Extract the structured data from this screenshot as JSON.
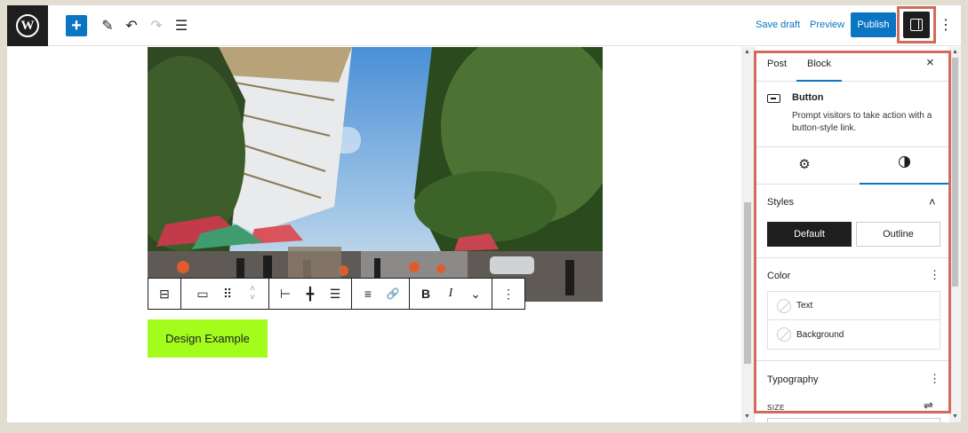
{
  "topbar": {
    "logo": "W",
    "add_icon": "+",
    "pen_icon": "✎",
    "undo_icon": "↶",
    "redo_icon": "↷",
    "outline_icon": "☰",
    "save_draft": "Save draft",
    "preview": "Preview",
    "publish": "Publish",
    "kebab_icon": "⋮"
  },
  "canvas": {
    "button_text": "Design Example"
  },
  "toolbar": {
    "transform_icon": "⊟",
    "button_icon": "▭",
    "drag_icon": "⠿",
    "up_icon": "˄",
    "down_icon": "˅",
    "justify_left_icon": "⊢",
    "justify_center_icon": "╋",
    "justify_space_icon": "☰",
    "align_icon": "≡",
    "link_icon": "🔗",
    "bold": "B",
    "italic": "I",
    "more_chevron": "⌄",
    "options_icon": "⋮"
  },
  "sidebar": {
    "tabs": {
      "post": "Post",
      "block": "Block",
      "close": "×"
    },
    "block_name": "Button",
    "block_desc": "Prompt visitors to take action with a button-style link.",
    "settings_icon": "⚙",
    "styles": {
      "title": "Styles",
      "collapse_icon": "˄",
      "default": "Default",
      "outline": "Outline"
    },
    "color": {
      "title": "Color",
      "menu_icon": "⋮",
      "items": [
        "Text",
        "Background"
      ]
    },
    "typography": {
      "title": "Typography",
      "menu_icon": "⋮",
      "size_label": "SIZE",
      "size_ctrl_icon": "⇌"
    }
  },
  "colors": {
    "accent": "#0a75c2",
    "button_bg": "#a4fc1c",
    "highlight": "#d26b5b"
  }
}
